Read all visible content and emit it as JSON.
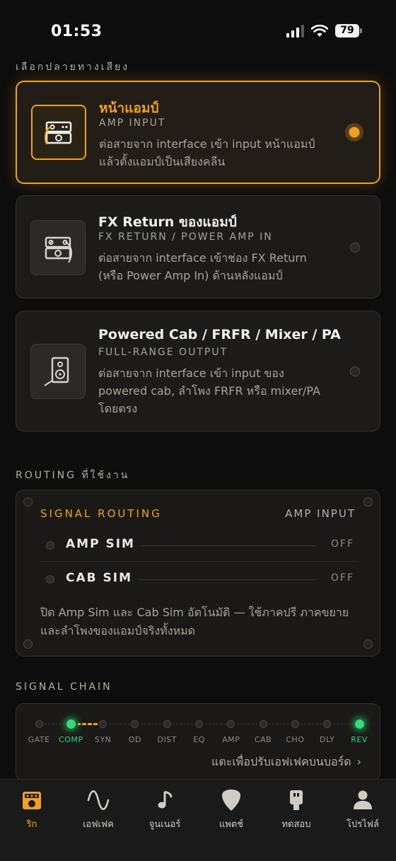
{
  "status": {
    "time": "01:53",
    "battery": "79"
  },
  "routing_section_title": "เลือกปลายทางเสียง",
  "routes": [
    {
      "title": "หน้าแอมป์",
      "subtitle": "AMP INPUT",
      "desc_line1": "ต่อสายจาก interface เข้า input หน้าแอมป์",
      "desc_line2": "แล้วตั้งแอมป์เป็นเสียงคลีน",
      "desc_line3": "",
      "selected": true,
      "icon": "amp-head-icon"
    },
    {
      "title": "FX Return ของแอมป์",
      "subtitle": "FX RETURN / POWER AMP IN",
      "desc_line1": "ต่อสายจาก interface เข้าช่อง FX Return",
      "desc_line2": "(หรือ Power Amp In) ด้านหลังแอมป์",
      "desc_line3": "",
      "selected": false,
      "icon": "amp-rear-icon"
    },
    {
      "title": "Powered Cab / FRFR / Mixer / PA",
      "subtitle": "FULL-RANGE OUTPUT",
      "desc_line1": "ต่อสายจาก interface เข้า input ของ",
      "desc_line2": "powered cab, ลำโพง FRFR หรือ mixer/PA",
      "desc_line3": "โดยตรง",
      "selected": false,
      "icon": "speaker-icon"
    }
  ],
  "active_section_title": "ROUTING ที่ใช้งาน",
  "routing_panel": {
    "heading": "SIGNAL ROUTING",
    "mode": "AMP INPUT",
    "rows": [
      {
        "name": "AMP SIM",
        "state": "OFF"
      },
      {
        "name": "CAB SIM",
        "state": "OFF"
      }
    ],
    "note_line1": "ปิด Amp Sim และ Cab Sim อัตโนมัติ — ใช้ภาคปรี ภาคขยาย",
    "note_line2": "และลำโพงของแอมป์จริงทั้งหมด"
  },
  "chain_section_title": "SIGNAL CHAIN",
  "signal_chain": {
    "nodes": [
      {
        "label": "GATE",
        "on": false
      },
      {
        "label": "COMP",
        "on": true
      },
      {
        "label": "SYN",
        "on": false
      },
      {
        "label": "OD",
        "on": false
      },
      {
        "label": "DIST",
        "on": false
      },
      {
        "label": "EQ",
        "on": false
      },
      {
        "label": "AMP",
        "on": false
      },
      {
        "label": "CAB",
        "on": false
      },
      {
        "label": "CHO",
        "on": false
      },
      {
        "label": "DLY",
        "on": false
      },
      {
        "label": "REV",
        "on": true
      }
    ],
    "hint": "แตะเพื่อปรับเอฟเฟคบนบอร์ด",
    "hint_arrow": "›",
    "colors": {
      "active": "#37d97a",
      "link": "#f0a11e"
    }
  },
  "tabs": [
    {
      "label": "ริก",
      "icon": "amp-icon",
      "active": true
    },
    {
      "label": "เอฟเฟค",
      "icon": "sine-wave-icon",
      "active": false
    },
    {
      "label": "จูนเนอร์",
      "icon": "music-note-icon",
      "active": false
    },
    {
      "label": "แพตช์",
      "icon": "guitar-pick-icon",
      "active": false
    },
    {
      "label": "ทดสอบ",
      "icon": "usb-icon",
      "active": false
    },
    {
      "label": "โปรไฟล์",
      "icon": "person-icon",
      "active": false
    }
  ],
  "theme": {
    "accent": "#f0a11e",
    "background": "#0d0d0d",
    "card": "#1c1b19"
  }
}
